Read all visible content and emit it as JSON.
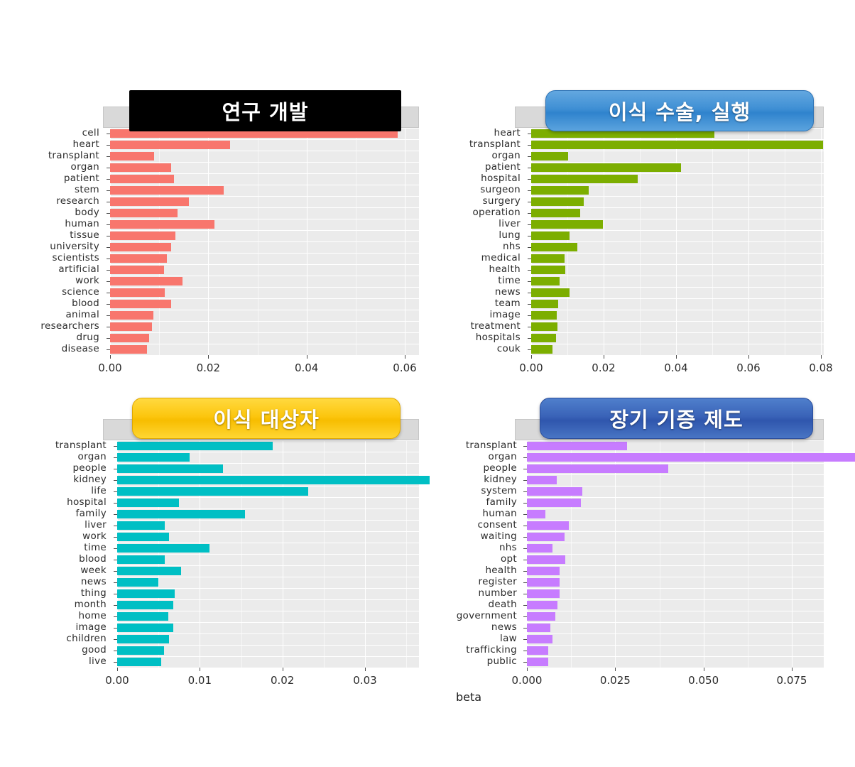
{
  "figure": {
    "xaxis_title": "beta",
    "background": "#ffffff"
  },
  "panels": [
    {
      "id": "panel-1",
      "overlay_title": "연구 개발",
      "overlay_style": "black",
      "overlay_bg": "#000000",
      "bar_color": "#f8766d",
      "x_ticks": [
        "0.00",
        "0.02",
        "0.04",
        "0.06"
      ]
    },
    {
      "id": "panel-2",
      "overlay_title": "이식 수술, 실행",
      "overlay_style": "blue",
      "overlay_bg": "#3f8fd4",
      "bar_color": "#7cae00",
      "x_ticks": [
        "0.00",
        "0.02",
        "0.04",
        "0.06",
        "0.08"
      ]
    },
    {
      "id": "panel-3",
      "overlay_title": "이식 대상자",
      "overlay_style": "gold",
      "overlay_bg": "#fcc60e",
      "bar_color": "#00bfc4",
      "x_ticks": [
        "0.00",
        "0.01",
        "0.02",
        "0.03"
      ]
    },
    {
      "id": "panel-4",
      "overlay_title": "장기 기증 제도",
      "overlay_style": "navy",
      "overlay_bg": "#3a63b8",
      "bar_color": "#c77cff",
      "x_ticks": [
        "0.000",
        "0.025",
        "0.050",
        "0.075"
      ]
    }
  ],
  "chart_data": [
    {
      "type": "bar",
      "orientation": "horizontal",
      "title": "연구 개발",
      "xlabel": "beta",
      "ylabel": "",
      "xlim": [
        0,
        0.0625
      ],
      "xticks": [
        0.0,
        0.02,
        0.04,
        0.06
      ],
      "grid": true,
      "legend": "none",
      "color": "#f8766d",
      "categories": [
        "cell",
        "heart",
        "transplant",
        "organ",
        "patient",
        "stem",
        "research",
        "body",
        "human",
        "tissue",
        "university",
        "scientists",
        "artificial",
        "work",
        "science",
        "blood",
        "animal",
        "researchers",
        "drug",
        "disease"
      ],
      "values": [
        0.0585,
        0.0245,
        0.009,
        0.0125,
        0.013,
        0.0232,
        0.016,
        0.0138,
        0.0212,
        0.0133,
        0.0125,
        0.0115,
        0.011,
        0.0148,
        0.0112,
        0.0125,
        0.0088,
        0.0085,
        0.008,
        0.0075
      ]
    },
    {
      "type": "bar",
      "orientation": "horizontal",
      "title": "이식 수술, 실행",
      "xlabel": "beta",
      "ylabel": "",
      "xlim": [
        0,
        0.0835
      ],
      "xticks": [
        0.0,
        0.02,
        0.04,
        0.06,
        0.08
      ],
      "grid": true,
      "legend": "none",
      "color": "#7cae00",
      "categories": [
        "heart",
        "transplant",
        "organ",
        "patient",
        "hospital",
        "surgeon",
        "surgery",
        "operation",
        "liver",
        "lung",
        "nhs",
        "medical",
        "health",
        "time",
        "news",
        "team",
        "image",
        "treatment",
        "hospitals",
        "couk"
      ],
      "values": [
        0.0505,
        0.0805,
        0.0102,
        0.0413,
        0.0295,
        0.0158,
        0.0145,
        0.0135,
        0.0198,
        0.0105,
        0.0128,
        0.0092,
        0.0095,
        0.0078,
        0.0105,
        0.0075,
        0.007,
        0.0072,
        0.0068,
        0.0058
      ]
    },
    {
      "type": "bar",
      "orientation": "horizontal",
      "title": "이식 대상자",
      "xlabel": "beta",
      "ylabel": "",
      "xlim": [
        0,
        0.0392
      ],
      "xticks": [
        0.0,
        0.01,
        0.02,
        0.03
      ],
      "grid": true,
      "legend": "none",
      "color": "#00bfc4",
      "categories": [
        "transplant",
        "organ",
        "people",
        "kidney",
        "life",
        "hospital",
        "family",
        "liver",
        "work",
        "time",
        "blood",
        "week",
        "news",
        "thing",
        "month",
        "home",
        "image",
        "children",
        "good",
        "live"
      ],
      "values": [
        0.0188,
        0.0088,
        0.0128,
        0.0378,
        0.0231,
        0.0075,
        0.0155,
        0.0058,
        0.0063,
        0.0112,
        0.0058,
        0.0077,
        0.005,
        0.007,
        0.0068,
        0.0062,
        0.0068,
        0.0063,
        0.0057,
        0.0053
      ]
    },
    {
      "type": "bar",
      "orientation": "horizontal",
      "title": "장기 기증 제도",
      "xlabel": "beta",
      "ylabel": "",
      "xlim": [
        0,
        0.1
      ],
      "xticks": [
        0.0,
        0.025,
        0.05,
        0.075
      ],
      "grid": true,
      "legend": "none",
      "color": "#c77cff",
      "categories": [
        "transplant",
        "organ",
        "people",
        "kidney",
        "system",
        "family",
        "human",
        "consent",
        "waiting",
        "nhs",
        "opt",
        "health",
        "register",
        "number",
        "death",
        "government",
        "news",
        "law",
        "trafficking",
        "public"
      ],
      "values": [
        0.0283,
        0.0955,
        0.04,
        0.0085,
        0.0157,
        0.0152,
        0.0053,
        0.0118,
        0.0106,
        0.0073,
        0.0108,
        0.0092,
        0.0092,
        0.0092,
        0.0086,
        0.008,
        0.0066,
        0.0073,
        0.006,
        0.006
      ]
    }
  ]
}
